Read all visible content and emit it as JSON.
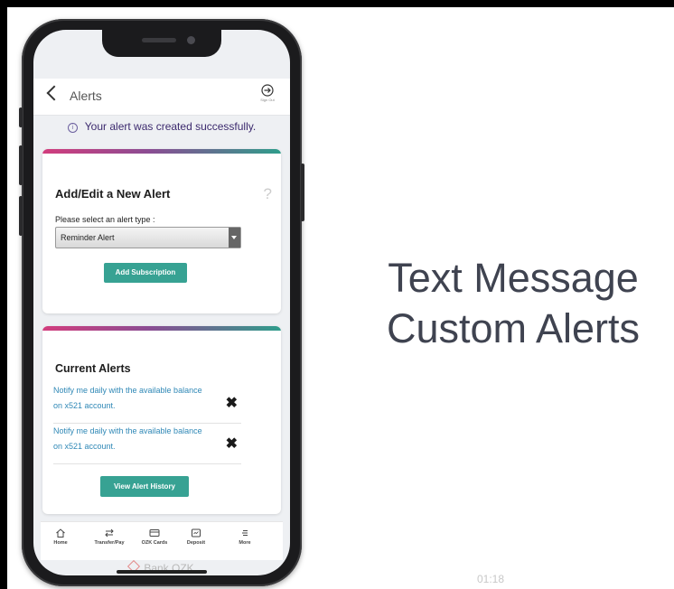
{
  "app": {
    "header": {
      "title": "Alerts",
      "signout_label": "Sign Out"
    },
    "info_message": "Your alert was created successfully.",
    "add_alert": {
      "title": "Add/Edit a New Alert",
      "help": "?",
      "field_label": "Please select an alert type :",
      "selected_value": "Reminder Alert",
      "button_label": "Add Subscription"
    },
    "current_alerts": {
      "title": "Current Alerts",
      "items": [
        {
          "text": "Notify me daily with the available balance on x521 account.",
          "remove": "✖"
        },
        {
          "text": "Notify me daily with the available balance on x521 account.",
          "remove": "✖"
        }
      ],
      "history_button_label": "View Alert History"
    },
    "tabs": [
      {
        "label": "Home",
        "icon": "home-icon"
      },
      {
        "label": "Transfer/Pay",
        "icon": "transfer-icon"
      },
      {
        "label": "OZK Cards",
        "icon": "card-icon"
      },
      {
        "label": "Deposit",
        "icon": "deposit-icon"
      },
      {
        "label": "More",
        "icon": "menu-icon"
      }
    ],
    "brand": "Bank OZK"
  },
  "headline": {
    "line1": "Text Message",
    "line2": "Custom Alerts"
  },
  "video": {
    "timestamp": "01:18"
  },
  "colors": {
    "accent": "#37a293",
    "link": "#2f88b6",
    "gradient": [
      "#d23d7d",
      "#8a4d93",
      "#2f9d8b"
    ]
  }
}
